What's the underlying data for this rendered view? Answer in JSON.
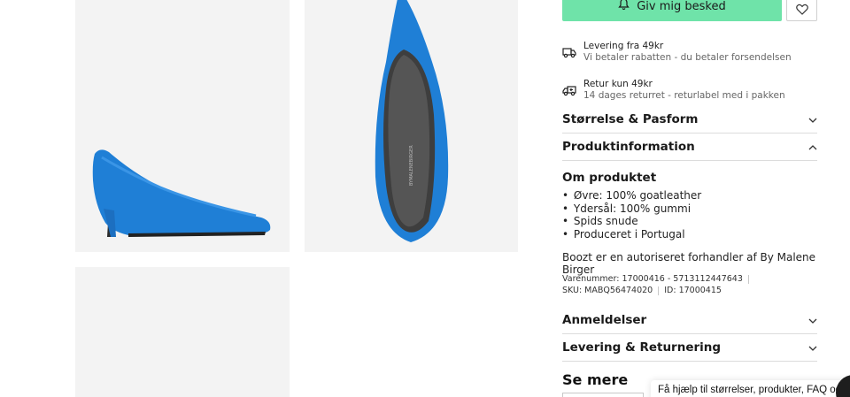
{
  "notify": {
    "label": "Giv mig besked",
    "icon": "bell-icon",
    "color": "#6fe3a9"
  },
  "wishlist": {
    "icon": "heart-icon"
  },
  "delivery": {
    "title": "Levering fra 49kr",
    "subtitle": "Vi betaler rabatten - du betaler forsendelsen",
    "icon": "truck-icon"
  },
  "returns": {
    "title": "Retur kun 49kr",
    "subtitle": "14 dages returret - returlabel med i pakken",
    "icon": "return-truck-icon"
  },
  "accordions": {
    "size": "Størrelse & Pasform",
    "info": "Produktinformation",
    "reviews": "Anmeldelser",
    "delivery": "Levering & Returnering"
  },
  "about": {
    "title": "Om produktet",
    "items": [
      "Øvre: 100% goatleather",
      "Ydersål: 100% gummi",
      "Spids snude",
      "Produceret i Portugal"
    ],
    "dealer": "Boozt er en autoriseret forhandler af By Malene Birger"
  },
  "meta": {
    "item_number": "Varenummer: 17000416 - 5713112447643",
    "sku": "SKU: MABQ56474020",
    "id": "ID: 17000415"
  },
  "see_more": "Se mere",
  "chat": {
    "text": "Få hjælp til størrelser, produkter, FAQ og"
  },
  "product_color": "#1f7fd6"
}
